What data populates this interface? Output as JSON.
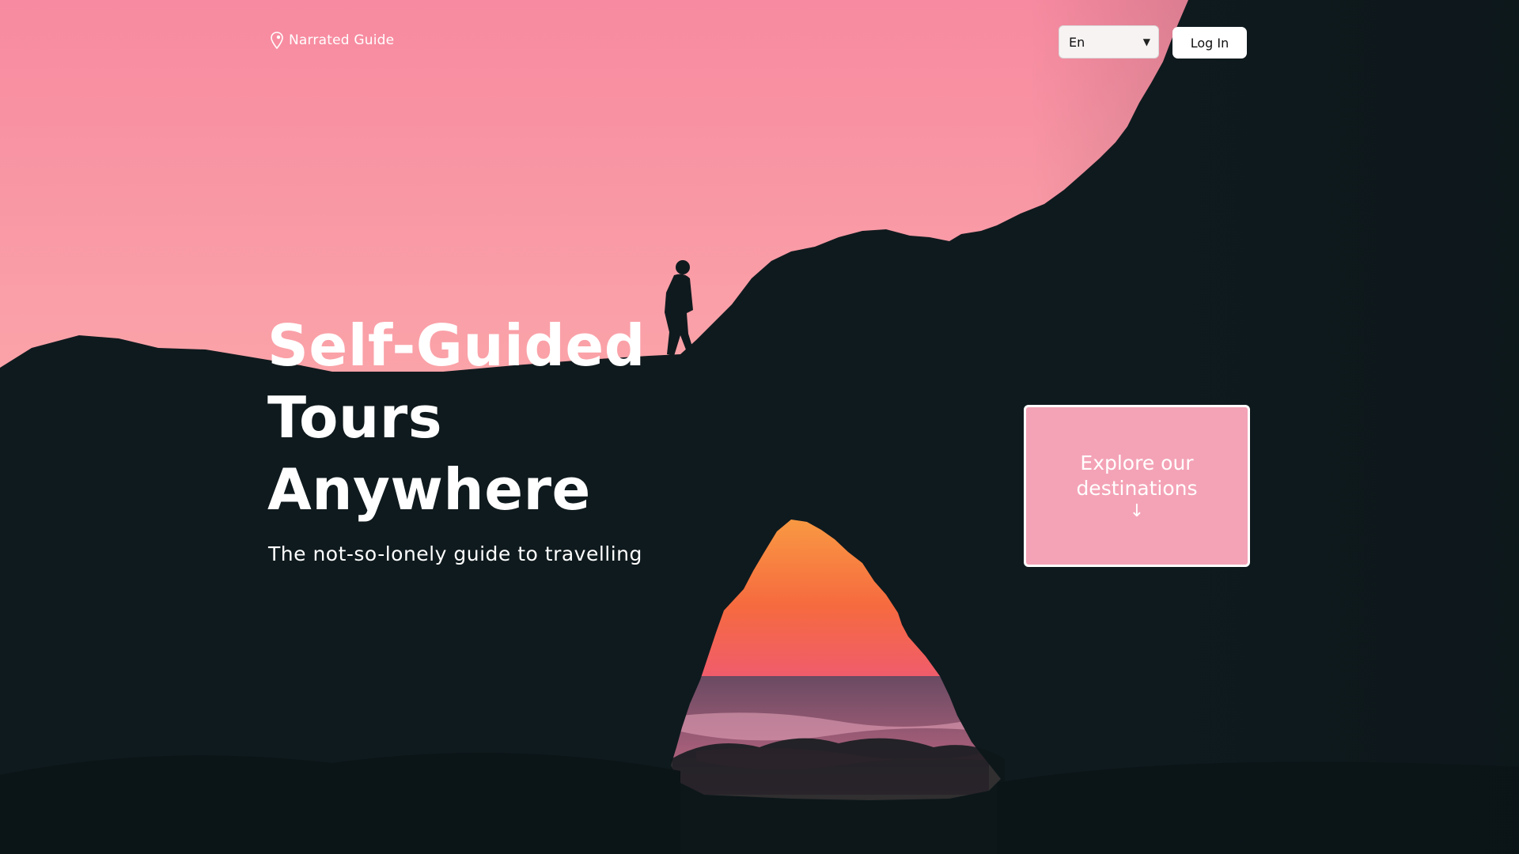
{
  "brand": {
    "name": "Narrated Guide",
    "icon": "map-pin-icon"
  },
  "header": {
    "language_selected": "En",
    "login_label": "Log In"
  },
  "hero": {
    "headline_lines": [
      "Self-Guided",
      "Tours",
      "Anywhere"
    ],
    "subheadline": "The not-so-lonely guide to travelling",
    "cta_label": "Explore our destinations",
    "cta_arrow": "↓"
  },
  "colors": {
    "sky_top": "#f78aa0",
    "sky_bottom": "#fbb7ae",
    "cta_background": "#f4a3b6",
    "rock": "#0f1a1e",
    "sunset_orange": "#f7873a"
  }
}
